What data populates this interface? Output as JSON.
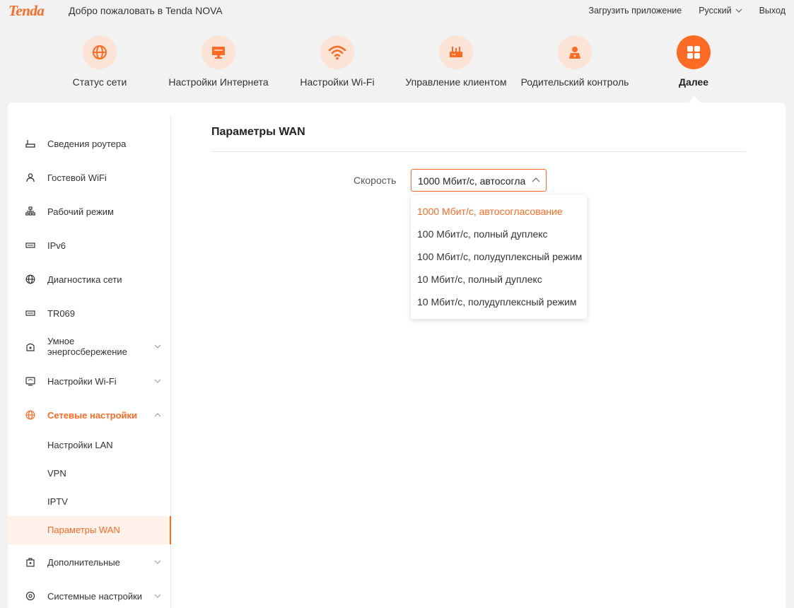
{
  "header": {
    "logo": "Tenda",
    "welcome": "Добро пожаловать в Tenda NOVA",
    "download_app": "Загрузить приложение",
    "language": "Русский",
    "logout": "Выход"
  },
  "nav": [
    {
      "label": "Статус сети",
      "icon": "globe-icon"
    },
    {
      "label": "Настройки Интернета",
      "icon": "monitor-icon"
    },
    {
      "label": "Настройки Wi-Fi",
      "icon": "wifi-icon"
    },
    {
      "label": "Управление клиентом",
      "icon": "router-icon"
    },
    {
      "label": "Родительский контроль",
      "icon": "parent-icon"
    },
    {
      "label": "Далее",
      "icon": "grid-icon",
      "active": true
    }
  ],
  "sidebar": {
    "items": [
      {
        "label": "Сведения роутера",
        "icon": "router-info-icon"
      },
      {
        "label": "Гостевой WiFi",
        "icon": "guest-icon"
      },
      {
        "label": "Рабочий режим",
        "icon": "network-mode-icon"
      },
      {
        "label": "IPv6",
        "icon": "ipv6-icon"
      },
      {
        "label": "Диагностика сети",
        "icon": "globe-icon"
      },
      {
        "label": "TR069",
        "icon": "tr069-icon"
      },
      {
        "label": "Умное\nэнергосбережение",
        "label_line1": "Умное",
        "label_line2": "энергосбережение",
        "icon": "power-save-icon"
      },
      {
        "label": "Настройки Wi-Fi",
        "icon": "wifi-settings-icon"
      },
      {
        "label": "Сетевые настройки",
        "icon": "globe-icon",
        "open": true
      },
      {
        "label": "Дополнительные",
        "icon": "advanced-icon"
      },
      {
        "label": "Системные настройки",
        "icon": "system-icon"
      }
    ],
    "subitems": [
      {
        "label": "Настройки LAN"
      },
      {
        "label": "VPN"
      },
      {
        "label": "IPTV"
      },
      {
        "label": "Параметры WAN",
        "active": true
      }
    ]
  },
  "content": {
    "title": "Параметры WAN",
    "speed_label": "Скорость",
    "speed_value": "1000 Мбит/с, автосогла",
    "options": [
      "1000 Мбит/с, автосогласование",
      "100 Мбит/с, полный дуплекс",
      "100 Мбит/с, полудуплексный режим",
      "10 Мбит/с, полный дуплекс",
      "10 Мбит/с, полудуплексный режим"
    ],
    "selected_option_index": 0
  },
  "colors": {
    "accent": "#ff6a24",
    "accent_light": "#fbe4d5",
    "background": "#f2f2f2"
  }
}
